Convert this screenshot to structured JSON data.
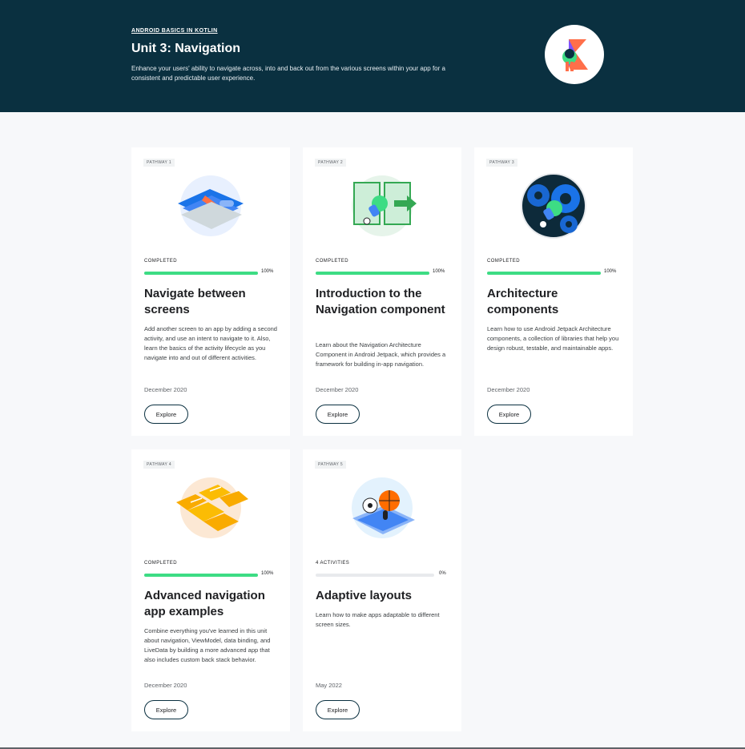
{
  "hero": {
    "breadcrumb": "ANDROID BASICS IN KOTLIN",
    "title": "Unit 3: Navigation",
    "description": "Enhance your users' ability to navigate across, into and back out from the various screens within your app for a consistent and predictable user experience.",
    "badge_icon": "kotlin-badge-icon"
  },
  "cards": [
    {
      "tag": "PATHWAY 1",
      "status": "COMPLETED",
      "progress_label": "100%",
      "progress": 1.0,
      "title": "Navigate between screens",
      "description": "Add another screen to an app by adding a second activity, and use an intent to navigate to it. Also, learn the basics of the activity lifecycle as you navigate into and out of different activities.",
      "date": "December 2020",
      "button": "Explore",
      "art_icon": "screens-illustration-icon"
    },
    {
      "tag": "PATHWAY 2",
      "status": "COMPLETED",
      "progress_label": "100%",
      "progress": 1.0,
      "title": "Introduction to the Navigation component",
      "description": "Learn about the Navigation Architecture Component in Android Jetpack, which provides a framework for building in-app navigation.",
      "date": "December 2020",
      "button": "Explore",
      "art_icon": "navigation-illustration-icon"
    },
    {
      "tag": "PATHWAY 3",
      "status": "COMPLETED",
      "progress_label": "100%",
      "progress": 1.0,
      "title": "Architecture components",
      "description": "Learn how to use Android Jetpack Architecture components, a collection of libraries that help you design robust, testable, and maintainable apps.",
      "date": "December 2020",
      "button": "Explore",
      "art_icon": "gears-illustration-icon"
    },
    {
      "tag": "PATHWAY 4",
      "status": "COMPLETED",
      "progress_label": "100%",
      "progress": 1.0,
      "title": "Advanced navigation app examples",
      "description": "Combine everything you've learned in this unit about navigation, ViewModel, data binding, and LiveData by building a more advanced app that also includes custom back stack behavior.",
      "date": "December 2020",
      "button": "Explore",
      "art_icon": "cards-illustration-icon"
    },
    {
      "tag": "PATHWAY 5",
      "status": "4 ACTIVITIES",
      "progress_label": "0%",
      "progress": 0.0,
      "title": "Adaptive layouts",
      "description": "Learn how to make apps adaptable to different screen sizes.",
      "date": "May 2022",
      "button": "Explore",
      "art_icon": "sports-illustration-icon"
    }
  ],
  "colors": {
    "hero_bg": "#0a3040",
    "progress": "#3ddc84",
    "page_bg": "#f7f8fa"
  }
}
